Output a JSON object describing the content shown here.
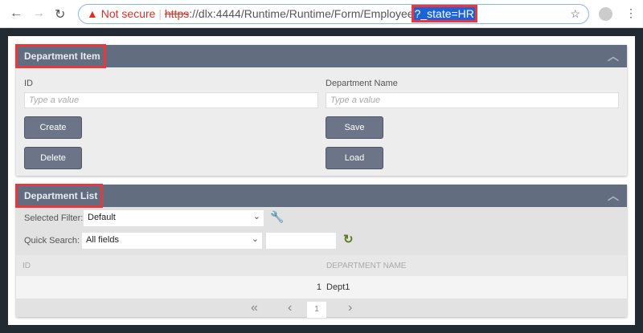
{
  "browser": {
    "not_secure": "Not secure",
    "scheme": "https",
    "url_rest": "://dlx:4444/Runtime/Runtime/Form/Employee",
    "url_selected": "?_state=HR"
  },
  "item_panel": {
    "title": "Department Item",
    "id_label": "ID",
    "id_placeholder": "Type a value",
    "name_label": "Department Name",
    "name_placeholder": "Type a value",
    "create": "Create",
    "delete": "Delete",
    "save": "Save",
    "load": "Load"
  },
  "list_panel": {
    "title": "Department List",
    "filter_label": "Selected Filter:",
    "filter_value": "Default",
    "search_label": "Quick Search:",
    "search_field": "All fields",
    "search_value": "",
    "columns": [
      "ID",
      "DEPARTMENT NAME"
    ],
    "rows": [
      {
        "id": "1",
        "name": "Dept1"
      }
    ],
    "page": "1"
  }
}
